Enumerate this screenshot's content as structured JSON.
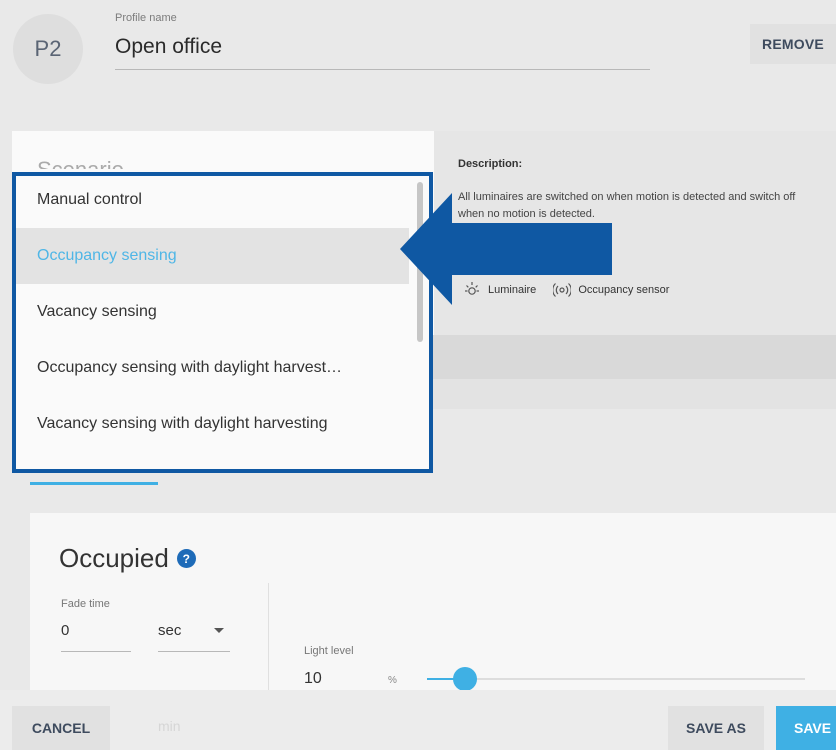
{
  "header": {
    "avatar_text": "P2",
    "profile_name_label": "Profile name",
    "profile_name_value": "Open office",
    "remove_label": "REMOVE"
  },
  "scenario": {
    "label": "Scenario",
    "description_title": "Description:",
    "description_text": "All luminaires are switched on when motion is detected and switch off when no motion is detected.",
    "legend": [
      {
        "icon": "luminaire-icon",
        "label": "Luminaire"
      },
      {
        "icon": "occupancy-sensor-icon",
        "label": "Occupancy sensor"
      }
    ]
  },
  "dropdown": {
    "items": [
      "Manual control",
      "Occupancy sensing",
      "Vacancy sensing",
      "Occupancy sensing with daylight harvest…",
      "Vacancy sensing with daylight harvesting"
    ],
    "selected": "Occupancy sensing"
  },
  "occupied": {
    "title": "Occupied",
    "help_symbol": "?",
    "fade_time_label": "Fade time",
    "fade_time_value": "0",
    "fade_time_unit": "sec",
    "light_level_label": "Light level",
    "light_level_value": "10",
    "light_level_unit": "%",
    "light_level_percent": 10
  },
  "footer": {
    "cancel_label": "CANCEL",
    "save_as_label": "SAVE AS",
    "save_label": "SAVE",
    "ghost_text": "min"
  },
  "colors": {
    "accent": "#3fb0e4",
    "callout_blue": "#0f58a3"
  }
}
